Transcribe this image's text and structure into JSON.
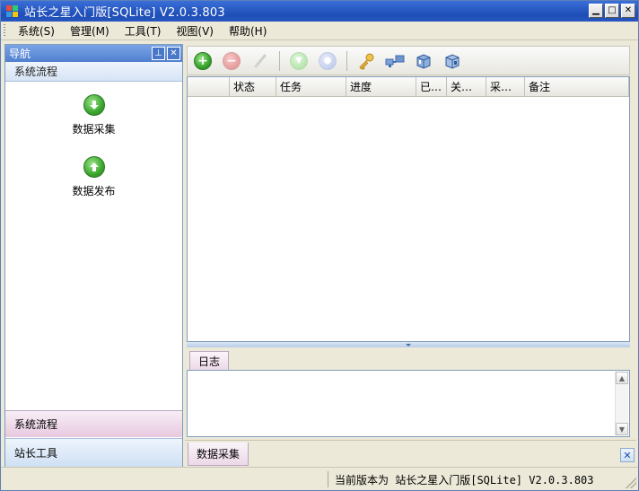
{
  "window": {
    "title": "站长之星入门版[SQLite] V2.0.3.803"
  },
  "menu": [
    {
      "label": "系统(S)"
    },
    {
      "label": "管理(M)"
    },
    {
      "label": "工具(T)"
    },
    {
      "label": "视图(V)"
    },
    {
      "label": "帮助(H)"
    }
  ],
  "nav": {
    "title": "导航",
    "section": "系统流程",
    "tools": [
      {
        "label": "数据采集",
        "icon": "download-arrow-icon"
      },
      {
        "label": "数据发布",
        "icon": "upload-arrow-icon"
      }
    ],
    "bottom_tabs": [
      {
        "label": "系统流程"
      },
      {
        "label": "站长工具"
      }
    ]
  },
  "toolbar": {
    "buttons": [
      "add-icon",
      "remove-icon",
      "clear-icon",
      "start-icon",
      "stop-icon",
      "key-icon",
      "network-icon",
      "server-icon",
      "server-alt-icon"
    ]
  },
  "grid": {
    "columns": [
      "",
      "状态",
      "任务",
      "进度",
      "已…",
      "关…",
      "采…",
      "备注"
    ],
    "rows": []
  },
  "log": {
    "tab": "日志"
  },
  "doc_tab": "数据采集",
  "status": {
    "text": "当前版本为 站长之星入门版[SQLite] V2.0.3.803"
  },
  "colors": {
    "titlebar": "#2a5bc5",
    "accent_green": "#3aa52d",
    "nav_header": "#4f7fcf"
  }
}
